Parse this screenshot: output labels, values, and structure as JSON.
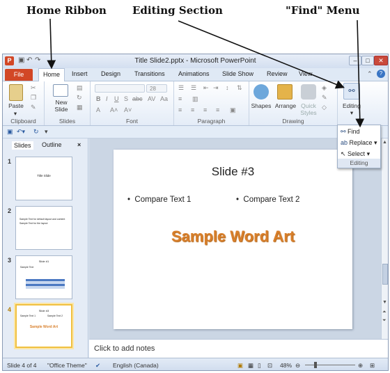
{
  "callouts": {
    "home_ribbon": "Home Ribbon",
    "editing_section": "Editing Section",
    "find_menu": "\"Find\" Menu"
  },
  "window": {
    "title": "Title Slide2.pptx - Microsoft PowerPoint",
    "app_letter": "P"
  },
  "tabs": {
    "file": "File",
    "items": [
      "Home",
      "Insert",
      "Design",
      "Transitions",
      "Animations",
      "Slide Show",
      "Review",
      "View"
    ]
  },
  "ribbon": {
    "clipboard": {
      "label": "Clipboard",
      "paste": "Paste"
    },
    "slides": {
      "label": "Slides",
      "new_slide_line1": "New",
      "new_slide_line2": "Slide"
    },
    "font": {
      "label": "Font",
      "size": "28"
    },
    "paragraph": {
      "label": "Paragraph"
    },
    "drawing": {
      "label": "Drawing",
      "shapes": "Shapes",
      "arrange": "Arrange",
      "quick_styles_line1": "Quick",
      "quick_styles_line2": "Styles"
    },
    "editing": {
      "label": "Editing"
    }
  },
  "find_menu": {
    "items": [
      "Find",
      "Replace",
      "Select"
    ],
    "label": "Editing"
  },
  "left_pane": {
    "tabs": [
      "Slides",
      "Outline"
    ],
    "close": "×",
    "slides": [
      {
        "num": "1",
        "title": "Title Slide"
      },
      {
        "num": "2",
        "bullets": [
          "Sample Text for default layout and content",
          "Sample Text for the layout"
        ]
      },
      {
        "num": "3",
        "title": "Slide #1",
        "bullet": "Sample Text"
      },
      {
        "num": "4",
        "title": "Slide #3",
        "bullets": [
          "Sample Text 1",
          "Sample Text 2"
        ],
        "wordart": "Sample Word Art"
      }
    ]
  },
  "slide": {
    "title": "Slide #3",
    "bullet1": "Compare Text 1",
    "bullet2": "Compare Text 2",
    "wordart": "Sample Word Art",
    "wordart_color": "#d87f2b"
  },
  "notes": {
    "placeholder": "Click to add notes"
  },
  "status": {
    "slide_of": "Slide 4 of 4",
    "theme": "\"Office Theme\"",
    "language": "English (Canada)",
    "zoom": "48%"
  },
  "colors": {
    "file_tab": "#d24726",
    "frame": "#dfe9f5"
  }
}
